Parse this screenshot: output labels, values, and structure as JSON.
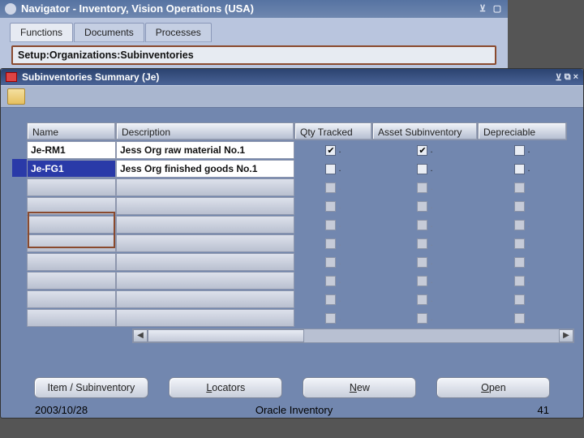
{
  "navigator": {
    "title": "Navigator - Inventory, Vision Operations (USA)",
    "tabs": [
      "Functions",
      "Documents",
      "Processes"
    ],
    "breadcrumb": "Setup:Organizations:Subinventories"
  },
  "window": {
    "title": "Subinventories Summary (Je)"
  },
  "columns": {
    "name": "Name",
    "desc": "Description",
    "qty": "Qty Tracked",
    "asset": "Asset Subinventory",
    "dep": "Depreciable"
  },
  "rows": [
    {
      "name": "Je-RM1",
      "desc": "Jess Org raw material No.1",
      "qty": true,
      "asset": true,
      "dep": false,
      "active": true,
      "selected": false
    },
    {
      "name": "Je-FG1",
      "desc": "Jess Org finished goods No.1",
      "qty": false,
      "asset": false,
      "dep": false,
      "active": true,
      "selected": true
    },
    {
      "name": "",
      "desc": "",
      "qty": false,
      "asset": false,
      "dep": false,
      "active": false,
      "selected": false
    },
    {
      "name": "",
      "desc": "",
      "qty": false,
      "asset": false,
      "dep": false,
      "active": false,
      "selected": false
    },
    {
      "name": "",
      "desc": "",
      "qty": false,
      "asset": false,
      "dep": false,
      "active": false,
      "selected": false
    },
    {
      "name": "",
      "desc": "",
      "qty": false,
      "asset": false,
      "dep": false,
      "active": false,
      "selected": false
    },
    {
      "name": "",
      "desc": "",
      "qty": false,
      "asset": false,
      "dep": false,
      "active": false,
      "selected": false
    },
    {
      "name": "",
      "desc": "",
      "qty": false,
      "asset": false,
      "dep": false,
      "active": false,
      "selected": false
    },
    {
      "name": "",
      "desc": "",
      "qty": false,
      "asset": false,
      "dep": false,
      "active": false,
      "selected": false
    },
    {
      "name": "",
      "desc": "",
      "qty": false,
      "asset": false,
      "dep": false,
      "active": false,
      "selected": false
    }
  ],
  "buttons": {
    "itemsub": "Item / Subinventory",
    "locators": "Locators",
    "new": "New",
    "open": "Open"
  },
  "footer": {
    "date": "2003/10/28",
    "title": "Oracle Inventory",
    "page": "41"
  }
}
